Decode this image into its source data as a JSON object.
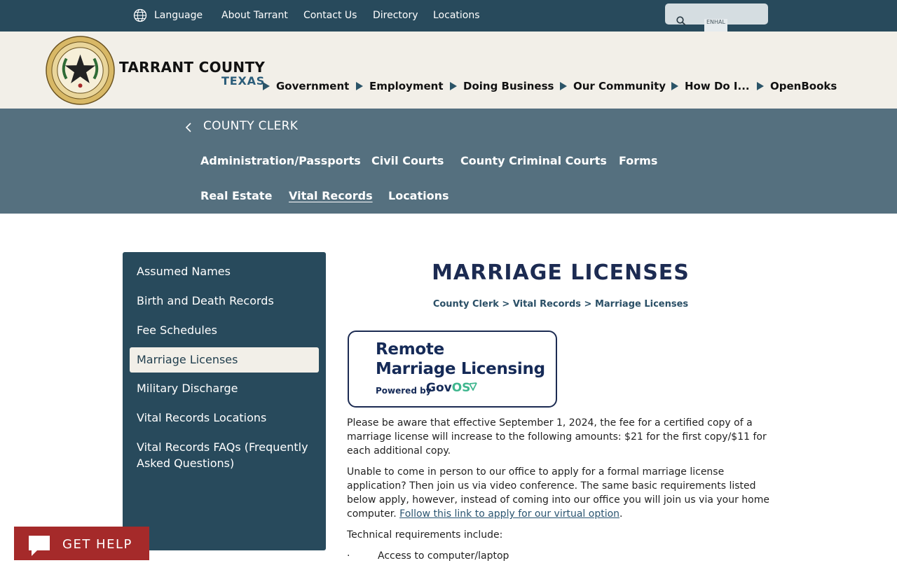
{
  "topbar": {
    "language_label": "Language",
    "links": [
      {
        "label": "About Tarrant"
      },
      {
        "label": "Contact Us"
      },
      {
        "label": "Directory"
      },
      {
        "label": "Locations"
      }
    ],
    "search_hint": "ENHAL"
  },
  "header": {
    "brand_name": "TARRANT COUNTY",
    "brand_state": "TEXAS",
    "nav": [
      {
        "label": "Government"
      },
      {
        "label": "Employment"
      },
      {
        "label": "Doing Business"
      },
      {
        "label": "Our Community"
      },
      {
        "label": "How Do I..."
      },
      {
        "label": "OpenBooks"
      }
    ]
  },
  "dept": {
    "title": "COUNTY CLERK",
    "nav_row1": [
      {
        "label": "Administration/Passports"
      },
      {
        "label": "Civil Courts"
      },
      {
        "label": "County Criminal Courts"
      },
      {
        "label": "Forms"
      }
    ],
    "nav_row2": [
      {
        "label": "Real Estate"
      },
      {
        "label": "Vital Records",
        "active": true
      },
      {
        "label": "Locations"
      }
    ]
  },
  "sidebar": {
    "items": [
      {
        "label": "Assumed Names"
      },
      {
        "label": "Birth and Death Records"
      },
      {
        "label": "Fee Schedules"
      },
      {
        "label": "Marriage Licenses",
        "active": true
      },
      {
        "label": "Military Discharge"
      },
      {
        "label": "Vital Records Locations"
      },
      {
        "label": "Vital Records FAQs (Frequently Asked Questions)"
      }
    ]
  },
  "main": {
    "title": "MARRIAGE LICENSES",
    "breadcrumb": "County Clerk > Vital Records > Marriage Licenses",
    "banner": {
      "line1": "Remote",
      "line2": "Marriage Licensing",
      "powered_by": "Powered by",
      "brand_gov": "Gov",
      "brand_os": "OS"
    },
    "para1": "Please be aware that effective September 1, 2024, the fee for a certified copy of a marriage license will increase to the following amounts: $21 for the first copy/$11 for each additional copy.",
    "para2_text": "Unable to come in person to our office to apply for a formal marriage license application? Then join us via video conference. The same basic requirements listed below apply, however, instead of coming into our office you will join us via your home computer. ",
    "para2_link": "Follow this link to apply for our virtual option",
    "para2_end": ".",
    "tech_label": "Technical requirements include:",
    "bullet_marker": "·",
    "bullet1": "Access to computer/laptop"
  },
  "help": {
    "label": "GET HELP"
  },
  "colors": {
    "topbar_bg": "#284a5c",
    "header_bg": "#f2efe8",
    "dept_bg": "#55707f",
    "sidebar_bg": "#284a5c",
    "title": "#1c2b52",
    "help_bg": "#a52a2a",
    "govos_accent": "#3fb68e"
  },
  "icons": {
    "language": "globe-icon",
    "search": "search-icon",
    "back": "chevron-left-icon",
    "help": "chat-bubble-icon"
  }
}
